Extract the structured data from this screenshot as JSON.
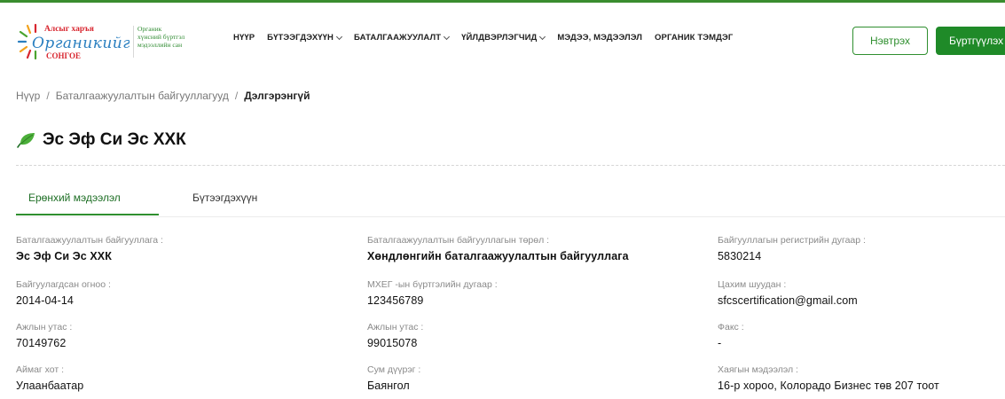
{
  "logo": {
    "top_line": "Алсыг харъя",
    "script_text": "Органикийг",
    "bottom_line": "СОНГОЕ"
  },
  "tagline": [
    "Органик",
    "хүнсний бүртгэл",
    "мэдээллийн сан"
  ],
  "nav": [
    {
      "label": "НҮҮР",
      "has_dropdown": false
    },
    {
      "label": "БҮТЭЭГДЭХҮҮН",
      "has_dropdown": true
    },
    {
      "label": "БАТАЛГААЖУУЛАЛТ",
      "has_dropdown": true
    },
    {
      "label": "ҮЙЛДВЭРЛЭГЧИД",
      "has_dropdown": true
    },
    {
      "label": "МЭДЭЭ, МЭДЭЭЛЭЛ",
      "has_dropdown": false
    },
    {
      "label": "ОРГАНИК ТЭМДЭГ",
      "has_dropdown": false
    }
  ],
  "auth": {
    "login_label": "Нэвтрэх",
    "register_label": "Бүртгүүлэх"
  },
  "breadcrumb": [
    {
      "label": "Нүүр"
    },
    {
      "label": "Баталгаажуулалтын байгууллагууд"
    },
    {
      "label": "Дэлгэрэнгүй"
    }
  ],
  "page": {
    "title": "Эс Эф Си Эс ХХК"
  },
  "tabs": [
    {
      "label": "Ерөнхий мэдээлэл",
      "active": true
    },
    {
      "label": "Бүтээгдэхүүн",
      "active": false
    }
  ],
  "fields": [
    {
      "label": "Баталгаажуулалтын байгууллага :",
      "value": "Эс Эф Си Эс ХХК"
    },
    {
      "label": "Баталгаажуулалтын байгууллагын төрөл :",
      "value": "Хөндлөнгийн баталгаажуулалтын байгууллага"
    },
    {
      "label": "Байгууллагын регистрийн дугаар :",
      "value": "5830214"
    },
    {
      "label": "Байгуулагдсан огноо :",
      "value": "2014-04-14"
    },
    {
      "label": "МХЕГ -ын бүртгэлийн дугаар :",
      "value": "123456789"
    },
    {
      "label": "Цахим шуудан :",
      "value": "sfcscertification@gmail.com"
    },
    {
      "label": "Ажлын утас :",
      "value": "70149762"
    },
    {
      "label": "Ажлын утас :",
      "value": "99015078"
    },
    {
      "label": "Факс :",
      "value": "-"
    },
    {
      "label": "Аймаг хот :",
      "value": "Улаанбаатар"
    },
    {
      "label": "Сум дүүрэг :",
      "value": "Баянгол"
    },
    {
      "label": "Хаягын мэдээлэл :",
      "value": "16-р хороо, Колорадо Бизнес төв 207 тоот"
    }
  ],
  "colors": {
    "brand_green": "#1f8a28",
    "accent_green": "#2f8f2f",
    "logo_red": "#d8262f",
    "logo_green": "#4aa42f",
    "logo_orange": "#f2a21c",
    "logo_blue": "#2a7fc0"
  },
  "icons": {
    "title": "leaf-icon",
    "nav_dropdown": "chevron-down-icon"
  }
}
